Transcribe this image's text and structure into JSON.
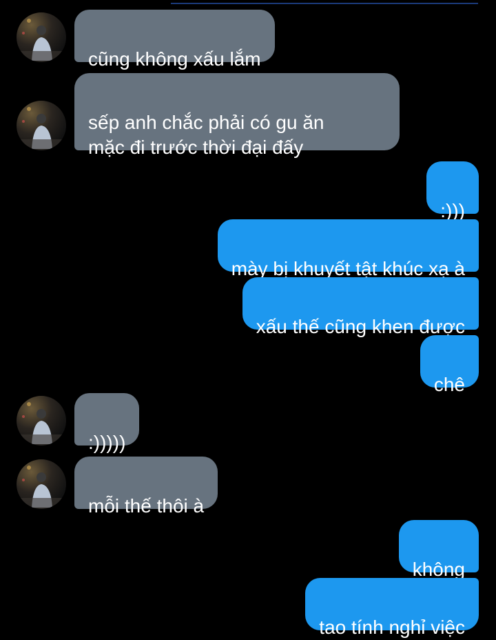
{
  "colors": {
    "background": "#000000",
    "incoming_bubble": "#67737f",
    "outgoing_bubble": "#1d98ef",
    "text": "#ffffff"
  },
  "contact": {
    "avatar_icon": "contact-avatar-photo"
  },
  "messages": [
    {
      "direction": "in",
      "text": "cũng không xấu lắm"
    },
    {
      "direction": "in",
      "text": "sếp anh chắc phải có gu ăn\nmặc đi trước thời đại đấy"
    },
    {
      "direction": "out",
      "text": ":)))"
    },
    {
      "direction": "out",
      "text": "mày bị khuyết tật khúc xạ à"
    },
    {
      "direction": "out",
      "text": "xấu thế cũng khen được"
    },
    {
      "direction": "out",
      "text": "chê"
    },
    {
      "direction": "in",
      "text": ":)))))"
    },
    {
      "direction": "in",
      "text": "mỗi thế thôi à"
    },
    {
      "direction": "out",
      "text": "không"
    },
    {
      "direction": "out",
      "text": "tao tính nghỉ việc"
    }
  ]
}
